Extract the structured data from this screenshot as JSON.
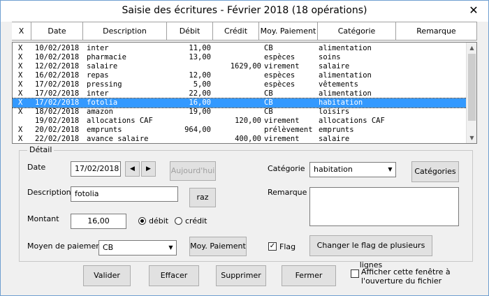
{
  "window": {
    "title": "Saisie des écritures - Février 2018 (18 opérations)",
    "close_glyph": "✕"
  },
  "columns": [
    "X",
    "Date",
    "Description",
    "Débit",
    "Crédit",
    "Moy. Paiement",
    "Catégorie",
    "Remarque"
  ],
  "rows": [
    {
      "x": "X",
      "date": "10/02/2018",
      "desc": "inter",
      "debit": "11,00",
      "credit": "",
      "moy": "CB",
      "cat": "alimentation"
    },
    {
      "x": "X",
      "date": "10/02/2018",
      "desc": "pharmacie",
      "debit": "13,00",
      "credit": "",
      "moy": "espèces",
      "cat": "soins"
    },
    {
      "x": "X",
      "date": "12/02/2018",
      "desc": "salaire",
      "debit": "",
      "credit": "1629,00",
      "moy": "virement",
      "cat": "salaire"
    },
    {
      "x": "X",
      "date": "16/02/2018",
      "desc": "repas",
      "debit": "12,00",
      "credit": "",
      "moy": "espèces",
      "cat": "alimentation"
    },
    {
      "x": "X",
      "date": "17/02/2018",
      "desc": "pressing",
      "debit": "5,00",
      "credit": "",
      "moy": "espèces",
      "cat": "vêtements"
    },
    {
      "x": "X",
      "date": "17/02/2018",
      "desc": "inter",
      "debit": "22,00",
      "credit": "",
      "moy": "CB",
      "cat": "alimentation"
    },
    {
      "x": "X",
      "date": "17/02/2018",
      "desc": "fotolia",
      "debit": "16,00",
      "credit": "",
      "moy": "CB",
      "cat": "habitation",
      "selected": true
    },
    {
      "x": "X",
      "date": "18/02/2018",
      "desc": "amazon",
      "debit": "19,00",
      "credit": "",
      "moy": "CB",
      "cat": "loisirs"
    },
    {
      "x": "",
      "date": "19/02/2018",
      "desc": "allocations CAF",
      "debit": "",
      "credit": "120,00",
      "moy": "virement",
      "cat": "allocations CAF"
    },
    {
      "x": "X",
      "date": "20/02/2018",
      "desc": "emprunts",
      "debit": "964,00",
      "credit": "",
      "moy": "prélèvement",
      "cat": "emprunts"
    },
    {
      "x": "X",
      "date": "22/02/2018",
      "desc": "avance salaire",
      "debit": "",
      "credit": "400,00",
      "moy": "virement",
      "cat": "salaire"
    }
  ],
  "detail": {
    "legend": "Détail",
    "date_label": "Date",
    "date_value": "17/02/2018",
    "prev_glyph": "◀",
    "next_glyph": "▶",
    "today_label": "Aujourd'hui",
    "desc_label": "Description",
    "desc_value": "fotolia",
    "raz_label": "raz",
    "amount_label": "Montant",
    "amount_value": "16,00",
    "debit_label": "débit",
    "credit_label": "crédit",
    "payment_label": "Moyen de paiement",
    "payment_value": "CB",
    "payment_button": "Moy. Paiement",
    "category_label": "Catégorie",
    "category_value": "habitation",
    "categories_button": "Catégories",
    "remark_label": "Remarque",
    "remark_value": "",
    "flag_label": "Flag",
    "flag_checked": true,
    "flag_button": "Changer le flag de plusieurs lignes"
  },
  "footer": {
    "validate": "Valider",
    "clear": "Effacer",
    "delete": "Supprimer",
    "close": "Fermer",
    "startup_line1": "Afficher cette fenêtre à",
    "startup_line2": "l'ouverture du fichier"
  },
  "colors": {
    "selection": "#3399ff",
    "window_border": "#6f9fd0"
  }
}
